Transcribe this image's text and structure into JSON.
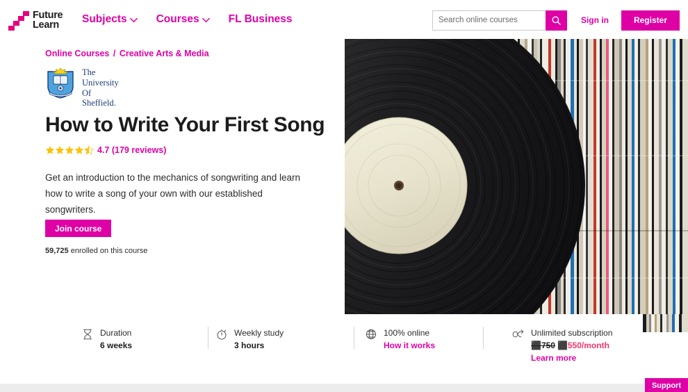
{
  "brand": {
    "accent": "#de00a5",
    "price_accent": "#f4356b",
    "star_color": "#ffc107",
    "logo_line1": "Future",
    "logo_line2": "Learn",
    "logo_icon": "staircase-icon"
  },
  "header": {
    "nav": [
      {
        "label": "Subjects",
        "icon": "chevron-down-icon",
        "has_chevron": true
      },
      {
        "label": "Courses",
        "icon": "chevron-down-icon",
        "has_chevron": true
      },
      {
        "label": "FL Business",
        "has_chevron": false
      }
    ],
    "search": {
      "placeholder": "Search online courses",
      "value": "",
      "button_icon": "search-icon"
    },
    "sign_in_label": "Sign in",
    "register_label": "Register"
  },
  "breadcrumb": {
    "first": "Online Courses",
    "separator": "/",
    "second": "Creative Arts & Media"
  },
  "provider": {
    "logo_icon": "university-crest-icon",
    "name": "The\nUniversity\nOf\nSheffield."
  },
  "course": {
    "title": "How to Write Your First Song",
    "rating_value": 4.7,
    "rating_stars_full": 4,
    "rating_stars_half": 1,
    "rating_text": "4.7 (179 reviews)",
    "reviews_count": 179,
    "description": "Get an introduction to the mechanics of songwriting and learn how to write a song of your own with our established songwriters.",
    "join_label": "Join course",
    "enrolled_count": "59,725",
    "enrolled_suffix": " enrolled on this course",
    "hero_image_alt": "vinyl-record-and-album-shelf-photo"
  },
  "stats": [
    {
      "icon": "hourglass-icon",
      "label": "Duration",
      "value": "6 weeks",
      "link": null,
      "price": null
    },
    {
      "icon": "stopwatch-icon",
      "label": "Weekly study",
      "value": "3 hours",
      "link": null,
      "price": null
    },
    {
      "icon": "globe-icon",
      "label": "100% online",
      "value": null,
      "link": "How it works",
      "price": null
    },
    {
      "icon": "infinity-arrow-icon",
      "label": "Unlimited subscription",
      "value": null,
      "link": "Learn more",
      "price": {
        "old": "⬛750",
        "new": "⬛550/month"
      }
    }
  ],
  "support": {
    "label": "Support"
  }
}
